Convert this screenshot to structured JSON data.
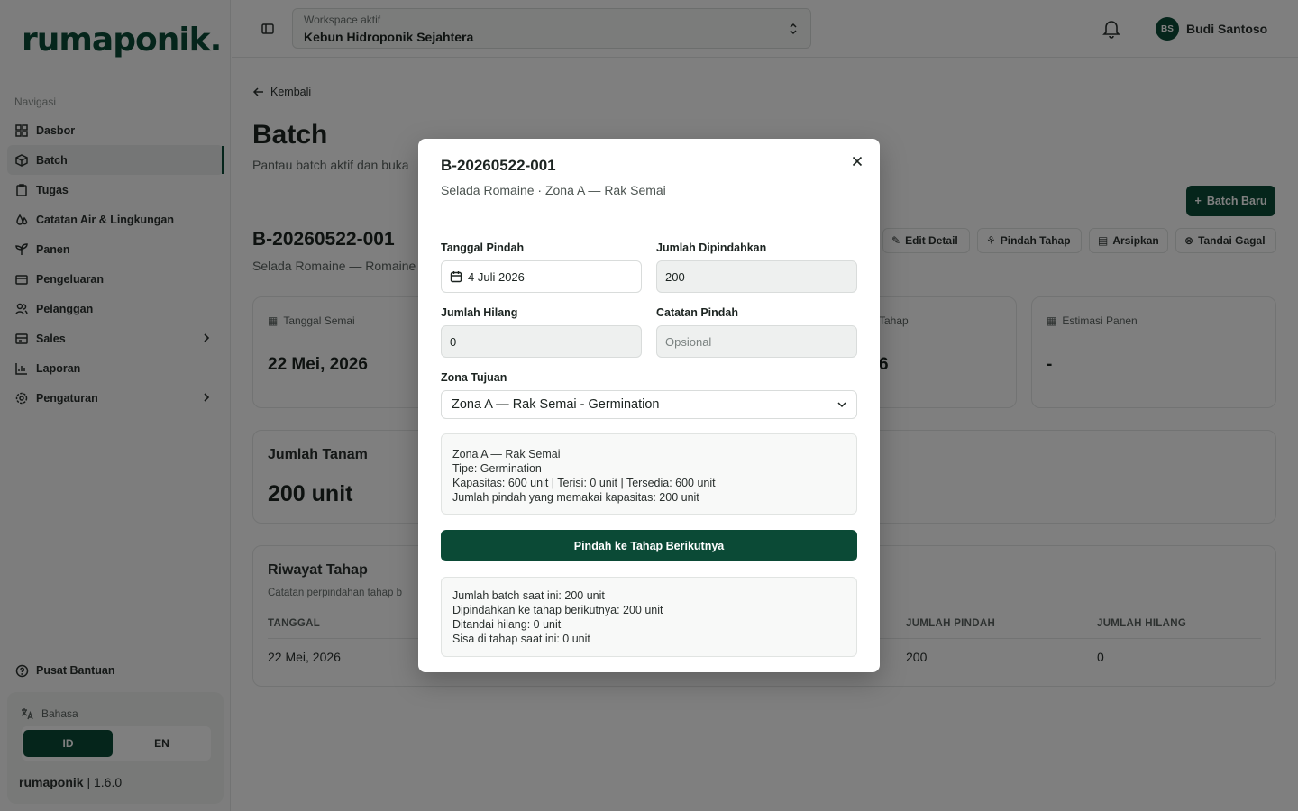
{
  "sidebar": {
    "logo": "rumaponik.",
    "nav_heading": "Navigasi",
    "items": [
      {
        "label": "Dasbor",
        "icon": "grid-icon"
      },
      {
        "label": "Batch",
        "icon": "box-icon",
        "active": true
      },
      {
        "label": "Tugas",
        "icon": "clipboard-icon"
      },
      {
        "label": "Catatan Air & Lingkungan",
        "icon": "droplet-icon"
      },
      {
        "label": "Panen",
        "icon": "sprout-icon"
      },
      {
        "label": "Pengeluaran",
        "icon": "wallet-icon"
      },
      {
        "label": "Pelanggan",
        "icon": "users-icon"
      },
      {
        "label": "Sales",
        "icon": "cart-icon"
      },
      {
        "label": "Laporan",
        "icon": "bar-chart-icon"
      },
      {
        "label": "Pengaturan",
        "icon": "settings-icon"
      }
    ],
    "help": "Pusat Bantuan",
    "language": {
      "label": "Bahasa",
      "options": [
        "ID",
        "EN"
      ],
      "selected": "ID"
    },
    "version_name": "rumaponik",
    "version_number": "1.6.0"
  },
  "topbar": {
    "workspace_label": "Workspace aktif",
    "workspace_value": "Kebun Hidroponik Sejahtera",
    "user_initials": "BS",
    "user_name": "Budi Santoso"
  },
  "page": {
    "back": "Kembali",
    "title": "Batch",
    "subtitle": "Pantau batch aktif dan buka",
    "new_button": "Batch Baru",
    "batch_code": "B-20260522-001",
    "batch_sub": "Selada Romaine — Romaine",
    "actions": [
      "Edit Detail",
      "Pindah Tahap",
      "Arsipkan",
      "Tandai Gagal"
    ],
    "cards": {
      "sow_date_label": "Tanggal Semai",
      "sow_date_value": "22 Mei, 2026",
      "stage_label": "Tahap",
      "stage_value": "6",
      "harvest_label": "Estimasi Panen",
      "harvest_value": "-",
      "plant_count_label": "Jumlah Tanam",
      "plant_count_value": "200 unit"
    },
    "history": {
      "title": "Riwayat Tahap",
      "subtitle": "Catatan perpindahan tahap b",
      "columns": [
        "TANGGAL",
        "JUMLAH PINDAH",
        "JUMLAH HILANG"
      ],
      "rows": [
        {
          "date": "22 Mei, 2026",
          "moved": "200",
          "lost": "0"
        }
      ]
    }
  },
  "modal": {
    "title": "B-20260522-001",
    "subtitle": "Selada Romaine · Zona A — Rak Semai",
    "move_date_label": "Tanggal Pindah",
    "move_date_value": "4 Juli 2026",
    "moved_qty_label": "Jumlah Dipindahkan",
    "moved_qty_value": "200",
    "lost_qty_label": "Jumlah Hilang",
    "lost_qty_value": "0",
    "note_label": "Catatan Pindah",
    "note_placeholder": "Opsional",
    "zone_label": "Zona Tujuan",
    "zone_value": "Zona A — Rak Semai - Germination",
    "zone_info": {
      "name": "Zona A — Rak Semai",
      "type": "Tipe: Germination",
      "capacity": "Kapasitas: 600 unit | Terisi: 0 unit | Tersedia: 600 unit",
      "usage": "Jumlah pindah yang memakai kapasitas: 200 unit"
    },
    "submit": "Pindah ke Tahap Berikutnya",
    "summary": {
      "current": "Jumlah batch saat ini: 200 unit",
      "moved": "Dipindahkan ke tahap berikutnya: 200 unit",
      "lost": "Ditandai hilang: 0 unit",
      "remaining": "Sisa di tahap saat ini: 0 unit"
    }
  },
  "colors": {
    "primary": "#0b4a36",
    "overlay": "rgba(0,0,0,0.5)"
  }
}
